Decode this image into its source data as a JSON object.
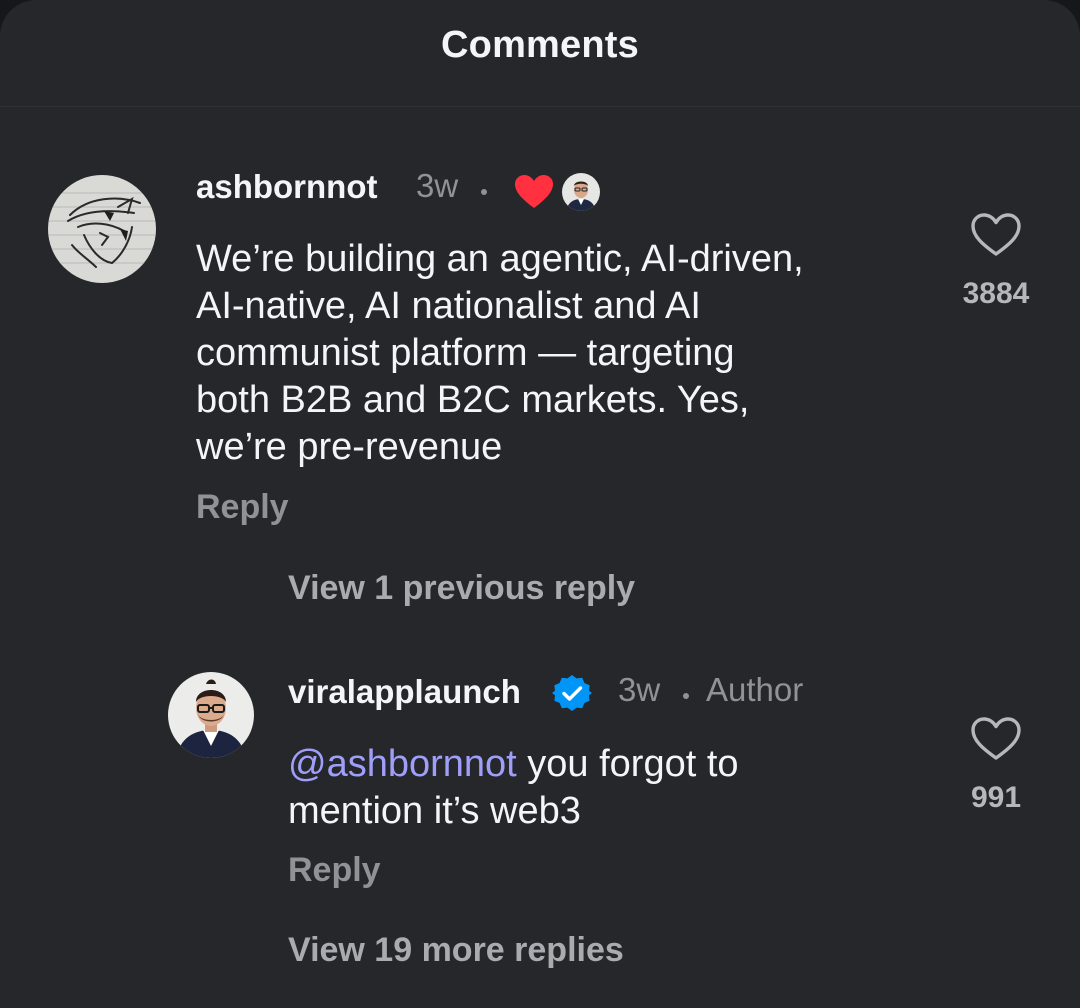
{
  "header": {
    "title": "Comments"
  },
  "comments": [
    {
      "username": "ashbornnot",
      "age": "3w",
      "text_lines": [
        "We’re building an agentic, AI-driven,",
        "AI-native, AI nationalist and AI",
        "communist platform — targeting",
        "both B2B and B2C markets. Yes,",
        "we’re pre-revenue"
      ],
      "reply_label": "Reply",
      "like_count": "3884",
      "liked_by_author": true
    }
  ],
  "thread": {
    "view_previous_label": "View 1 previous reply",
    "view_more_label": "View 19 more replies"
  },
  "reply": {
    "username": "viralapplaunch",
    "verified": true,
    "age": "3w",
    "role": "Author",
    "mention": "@ashbornnot",
    "text_line1_rest": " you forgot to",
    "text_line2": "mention it’s web3",
    "reply_label": "Reply",
    "like_count": "991"
  },
  "colors": {
    "background": "#25272b",
    "mention": "#9f9ffa",
    "verified_badge": "#0095f6",
    "author_heart": "#ff3040",
    "muted_text": "#8f9297"
  }
}
